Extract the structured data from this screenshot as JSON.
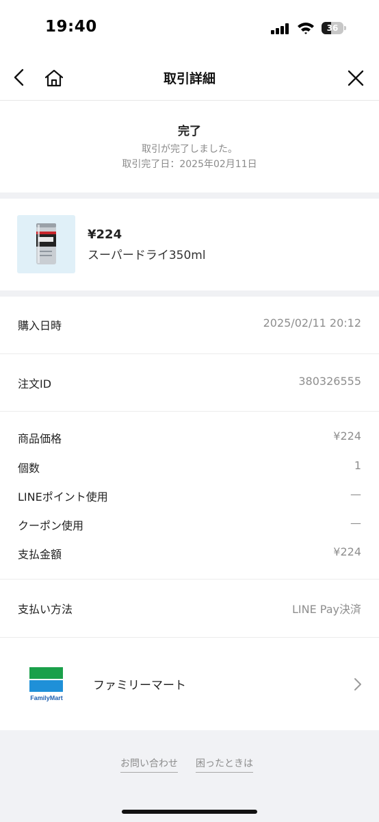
{
  "status_bar": {
    "time": "19:40",
    "battery": "36"
  },
  "header": {
    "title": "取引詳細",
    "icons": [
      "back-icon",
      "home-icon",
      "close-icon"
    ]
  },
  "transaction": {
    "status": "完了",
    "message": "取引が完了しました。",
    "completed_date": "取引完了日：2025年02月11日"
  },
  "product": {
    "price": "¥224",
    "name": "スーパードライ350ml"
  },
  "details": [
    {
      "label": "購入日時",
      "value": "2025/02/11 20:12"
    },
    {
      "label": "注文ID",
      "value": "380326555"
    },
    {
      "label": "商品価格",
      "value": "¥224"
    },
    {
      "label": "個数",
      "value": "1"
    },
    {
      "label": "LINEポイント使用",
      "value": "—"
    },
    {
      "label": "クーポン使用",
      "value": "—"
    },
    {
      "label": "支払金額",
      "value": "¥224"
    },
    {
      "label": "支払い方法",
      "value": "LINE Pay決済"
    }
  ],
  "store": {
    "name": "ファミリーマート",
    "logo_text": "FamilyMart"
  },
  "footer": {
    "links": [
      "お問い合わせ",
      "困ったときは"
    ]
  },
  "colors": {
    "familymart_green": "#1aa04a",
    "familymart_blue": "#1f90d8",
    "section_gap": "#f0f1f4"
  }
}
